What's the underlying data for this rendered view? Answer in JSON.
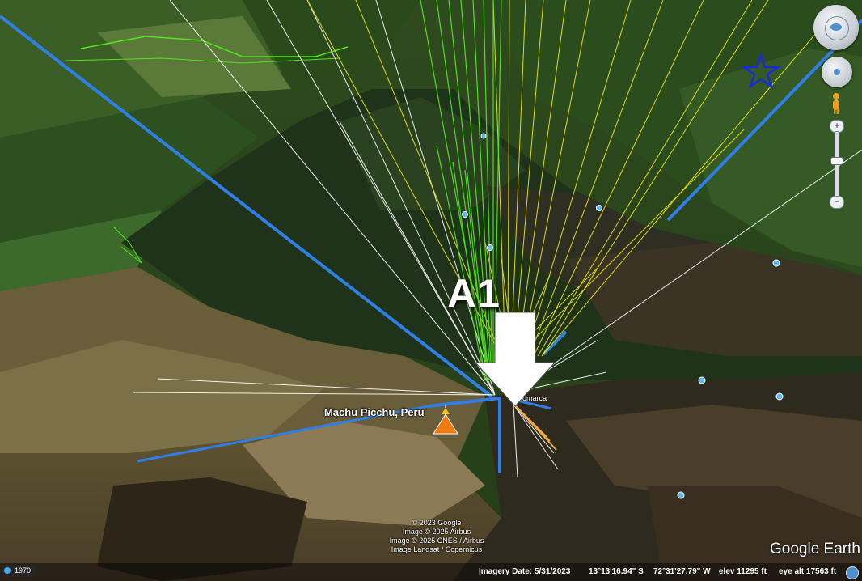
{
  "map": {
    "place_label": "Machu Picchu, Peru",
    "annotation_label": "A1",
    "road_label": "omarca",
    "place_icon": "volcano-icon",
    "marker_icon": "star-icon"
  },
  "attribution": {
    "line1": "© 2023 Google",
    "line2": "Image © 2025 Airbus",
    "line3": "Image © 2025 CNES / Airbus",
    "line4": "Image Landsat / Copernicus"
  },
  "logo": "Google Earth",
  "status": {
    "year": "1970",
    "imagery_date": "Imagery Date: 5/31/2023",
    "lat": "13°13'16.94\" S",
    "lon": "72°31'27.79\" W",
    "elev": "elev 11295 ft",
    "eye_alt": "eye alt  17563 ft"
  },
  "controls": {
    "zoom_in": "+",
    "zoom_out": "−",
    "icons": [
      "compass-icon",
      "move-joystick-icon",
      "pegman-icon",
      "zoom-slider"
    ]
  },
  "colors": {
    "blue_line": "#2f7fe6",
    "yellow_line": "#e6e21a",
    "green_line": "#4fe61c",
    "white_line": "#ffffff",
    "orange_line": "#f0a840",
    "star": "#1a2ad8"
  }
}
